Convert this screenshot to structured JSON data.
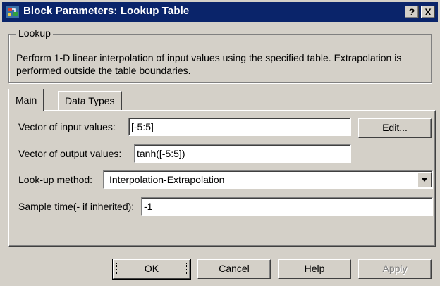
{
  "window": {
    "title": "Block Parameters: Lookup Table",
    "help_button": "?",
    "close_button": "X"
  },
  "description_group": {
    "legend": "Lookup",
    "text": "Perform 1-D linear interpolation of input values using the specified table.  Extrapolation is performed outside the table boundaries."
  },
  "tabs": [
    {
      "label": "Main",
      "active": true
    },
    {
      "label": "Data Types",
      "active": false
    }
  ],
  "main": {
    "input_values_label": "Vector of input values:",
    "input_values": "[-5:5]",
    "edit_button": "Edit...",
    "output_values_label": "Vector of output values:",
    "output_values": "tanh([-5:5])",
    "lookup_method_label": "Look-up method:",
    "lookup_method": "Interpolation-Extrapolation",
    "sample_time_label": "Sample time(- if inherited):",
    "sample_time": "-1"
  },
  "buttons": {
    "ok": "OK",
    "cancel": "Cancel",
    "help": "Help",
    "apply": "Apply"
  }
}
